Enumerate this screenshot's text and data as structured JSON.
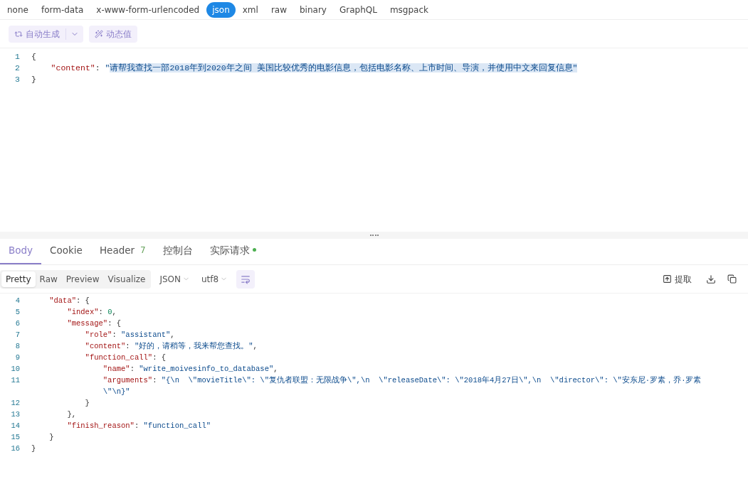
{
  "body_types": [
    {
      "label": "none",
      "selected": false
    },
    {
      "label": "form-data",
      "selected": false
    },
    {
      "label": "x-www-form-urlencoded",
      "selected": false
    },
    {
      "label": "json",
      "selected": true
    },
    {
      "label": "xml",
      "selected": false
    },
    {
      "label": "raw",
      "selected": false
    },
    {
      "label": "binary",
      "selected": false
    },
    {
      "label": "GraphQL",
      "selected": false
    },
    {
      "label": "msgpack",
      "selected": false
    }
  ],
  "request_toolbar": {
    "auto_generate": "自动生成",
    "dynamic_value": "动态值"
  },
  "request_code": [
    {
      "number": "1",
      "tokens": [
        {
          "kind": "p",
          "text": "{"
        }
      ]
    },
    {
      "number": "2",
      "tokens": [
        {
          "kind": "key",
          "text": "    \"content\""
        },
        {
          "kind": "p",
          "text": ": "
        },
        {
          "kind": "str",
          "text": "\""
        },
        {
          "kind": "sel",
          "text": "请帮我查找一部2018年到2020年之间 美国比较优秀的电影信息，包括电影名称、上市时间、导演，并使用中文来回复信息\""
        }
      ]
    },
    {
      "number": "3",
      "tokens": [
        {
          "kind": "p",
          "text": "}"
        }
      ]
    }
  ],
  "response_tabs": [
    {
      "label": "Body",
      "selected": true,
      "dot": false
    },
    {
      "label": "Cookie",
      "selected": false,
      "dot": false
    },
    {
      "label": "Header",
      "selected": false,
      "count": "7",
      "dot": false
    },
    {
      "label": "控制台",
      "selected": false,
      "dot": false
    },
    {
      "label": "实际请求",
      "selected": false,
      "dot": true
    }
  ],
  "view_modes": [
    {
      "label": "Pretty",
      "selected": true
    },
    {
      "label": "Raw",
      "selected": false
    },
    {
      "label": "Preview",
      "selected": false
    },
    {
      "label": "Visualize",
      "selected": false
    }
  ],
  "format_select": "JSON",
  "encoding_select": "utf8",
  "extract_button": "提取",
  "response_code": [
    {
      "number": "4",
      "tokens": [
        {
          "kind": "key",
          "text": "    \"data\""
        },
        {
          "kind": "p",
          "text": ": {"
        }
      ]
    },
    {
      "number": "5",
      "tokens": [
        {
          "kind": "key",
          "text": "        \"index\""
        },
        {
          "kind": "p",
          "text": ": "
        },
        {
          "kind": "num",
          "text": "0"
        },
        {
          "kind": "p",
          "text": ","
        }
      ]
    },
    {
      "number": "6",
      "tokens": [
        {
          "kind": "key",
          "text": "        \"message\""
        },
        {
          "kind": "p",
          "text": ": {"
        }
      ]
    },
    {
      "number": "7",
      "tokens": [
        {
          "kind": "key",
          "text": "            \"role\""
        },
        {
          "kind": "p",
          "text": ": "
        },
        {
          "kind": "str",
          "text": "\"assistant\""
        },
        {
          "kind": "p",
          "text": ","
        }
      ]
    },
    {
      "number": "8",
      "tokens": [
        {
          "kind": "key",
          "text": "            \"content\""
        },
        {
          "kind": "p",
          "text": ": "
        },
        {
          "kind": "str",
          "text": "\"好的，请稍等，我来帮您查找。\""
        },
        {
          "kind": "p",
          "text": ","
        }
      ]
    },
    {
      "number": "9",
      "tokens": [
        {
          "kind": "key",
          "text": "            \"function_call\""
        },
        {
          "kind": "p",
          "text": ": {"
        }
      ]
    },
    {
      "number": "10",
      "tokens": [
        {
          "kind": "key",
          "text": "                \"name\""
        },
        {
          "kind": "p",
          "text": ": "
        },
        {
          "kind": "str",
          "text": "\"write_moivesinfo_to_database\""
        },
        {
          "kind": "p",
          "text": ","
        }
      ]
    },
    {
      "number": "11",
      "tokens": [
        {
          "kind": "key",
          "text": "                \"arguments\""
        },
        {
          "kind": "p",
          "text": ": "
        },
        {
          "kind": "str",
          "text": "\"{\\n  \\\"movieTitle\\\": \\\"复仇者联盟：无限战争\\\",\\n  \\\"releaseDate\\\": \\\"2018年4月27日\\\",\\n  \\\"director\\\": \\\"安东尼·罗素，乔·罗素"
        }
      ]
    },
    {
      "tokens": [
        {
          "kind": "str",
          "text": "                \\\"\\n}\""
        }
      ]
    },
    {
      "number": "12",
      "tokens": [
        {
          "kind": "p",
          "text": "            }"
        }
      ]
    },
    {
      "number": "13",
      "tokens": [
        {
          "kind": "p",
          "text": "        },"
        }
      ]
    },
    {
      "number": "14",
      "tokens": [
        {
          "kind": "key",
          "text": "        \"finish_reason\""
        },
        {
          "kind": "p",
          "text": ": "
        },
        {
          "kind": "str",
          "text": "\"function_call\""
        }
      ]
    },
    {
      "number": "15",
      "tokens": [
        {
          "kind": "p",
          "text": "    }"
        }
      ]
    },
    {
      "number": "16",
      "tokens": [
        {
          "kind": "p",
          "text": "}"
        }
      ]
    }
  ]
}
